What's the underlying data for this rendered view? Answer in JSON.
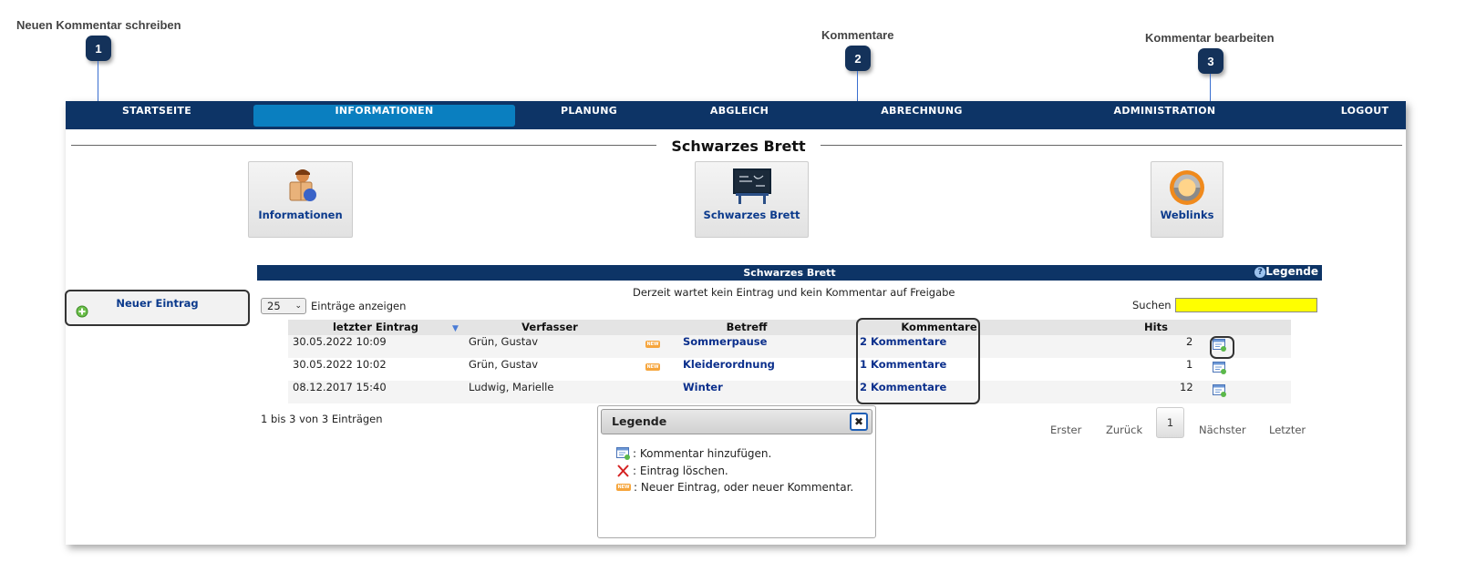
{
  "callouts": [
    {
      "number": "1",
      "label": "Neuen Kommentar schreiben"
    },
    {
      "number": "2",
      "label": "Kommentare"
    },
    {
      "number": "3",
      "label": "Kommentar bearbeiten"
    }
  ],
  "nav": {
    "items": [
      "STARTSEITE",
      "INFORMATIONEN",
      "PLANUNG",
      "ABGLEICH",
      "ABRECHNUNG",
      "ADMINISTRATION",
      "LOGOUT"
    ],
    "active": "INFORMATIONEN",
    "colors": {
      "bar": "#0d3466",
      "active": "#0a7fc0"
    }
  },
  "page": {
    "title": "Schwarzes Brett"
  },
  "tiles": [
    {
      "label": "Informationen",
      "icon": "reader-icon"
    },
    {
      "label": "Schwarzes Brett",
      "icon": "blackboard-icon"
    },
    {
      "label": "Weblinks",
      "icon": "weblinks-icon"
    }
  ],
  "sidebar": {
    "new_entry_label": "Neuer Eintrag",
    "icon": "add-icon"
  },
  "table": {
    "title": "Schwarzes Brett",
    "legend_link": "Legende",
    "status_message": "Derzeit wartet kein Eintrag und kein Kommentar auf Freigabe",
    "page_size": "25",
    "page_size_label": "Einträge anzeigen",
    "search_label": "Suchen",
    "search_value": "",
    "headers": [
      "letzter Eintrag",
      "Verfasser",
      "Betreff",
      "Kommentare",
      "Hits"
    ],
    "rows": [
      {
        "date": "30.05.2022 10:09",
        "author": "Grün, Gustav",
        "is_new": true,
        "subject": "Sommerpause",
        "comments": "2 Kommentare",
        "hits": "2"
      },
      {
        "date": "30.05.2022 10:02",
        "author": "Grün, Gustav",
        "is_new": true,
        "subject": "Kleiderordnung",
        "comments": "1 Kommentare",
        "hits": "1"
      },
      {
        "date": "08.12.2017 15:40",
        "author": "Ludwig, Marielle",
        "is_new": false,
        "subject": "Winter",
        "comments": "2 Kommentare",
        "hits": "12"
      }
    ],
    "info": "1 bis 3 von 3 Einträgen",
    "pagination": {
      "first": "Erster",
      "prev": "Zurück",
      "current": "1",
      "next": "Nächster",
      "last": "Letzter"
    },
    "new_tag": "NEW"
  },
  "legend_dialog": {
    "title": "Legende",
    "close_icon": "close-icon",
    "items": [
      {
        "icon": "comment-add-icon",
        "text": ": Kommentar hinzufügen."
      },
      {
        "icon": "delete-icon",
        "text": ": Eintrag löschen."
      },
      {
        "icon": "new-tag-icon",
        "text": ": Neuer Eintrag, oder neuer Kommentar."
      }
    ]
  },
  "colors": {
    "search_bg": "#ffff00",
    "link": "#0b2f8c",
    "callout": "#14325a",
    "callout_line": "#3a6fd0"
  }
}
